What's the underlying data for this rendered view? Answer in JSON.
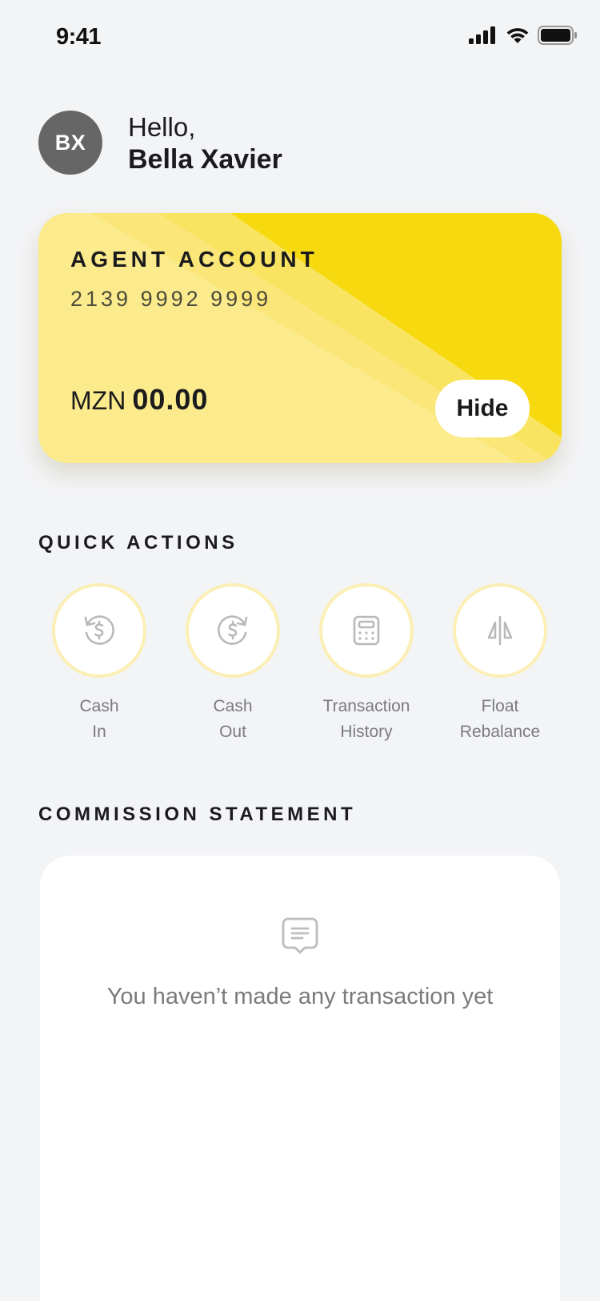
{
  "status_bar": {
    "time": "9:41",
    "icons": [
      "signal-icon",
      "wifi-icon",
      "battery-icon"
    ]
  },
  "user": {
    "initials": "BX",
    "greeting": "Hello,",
    "name": "Bella Xavier"
  },
  "account_card": {
    "title": "AGENT ACCOUNT",
    "number": "2139 9992 9999",
    "currency": "MZN",
    "balance": "00.00",
    "hide_label": "Hide",
    "colors": {
      "light": "#fbeb8c",
      "mid": "#f9e462",
      "accent": "#f7d90f"
    }
  },
  "quick_actions": {
    "heading": "QUICK ACTIONS",
    "items": [
      {
        "line1": "Cash",
        "line2": "In",
        "icon": "cash-in-icon"
      },
      {
        "line1": "Cash",
        "line2": "Out",
        "icon": "cash-out-icon"
      },
      {
        "line1": "Transaction",
        "line2": "History",
        "icon": "calculator-icon"
      },
      {
        "line1": "Float",
        "line2": "Rebalance",
        "icon": "rebalance-icon"
      }
    ]
  },
  "commission": {
    "heading": "COMMISSION STATEMENT",
    "empty_icon": "message-icon",
    "empty_message": "You haven’t made any transaction yet"
  }
}
